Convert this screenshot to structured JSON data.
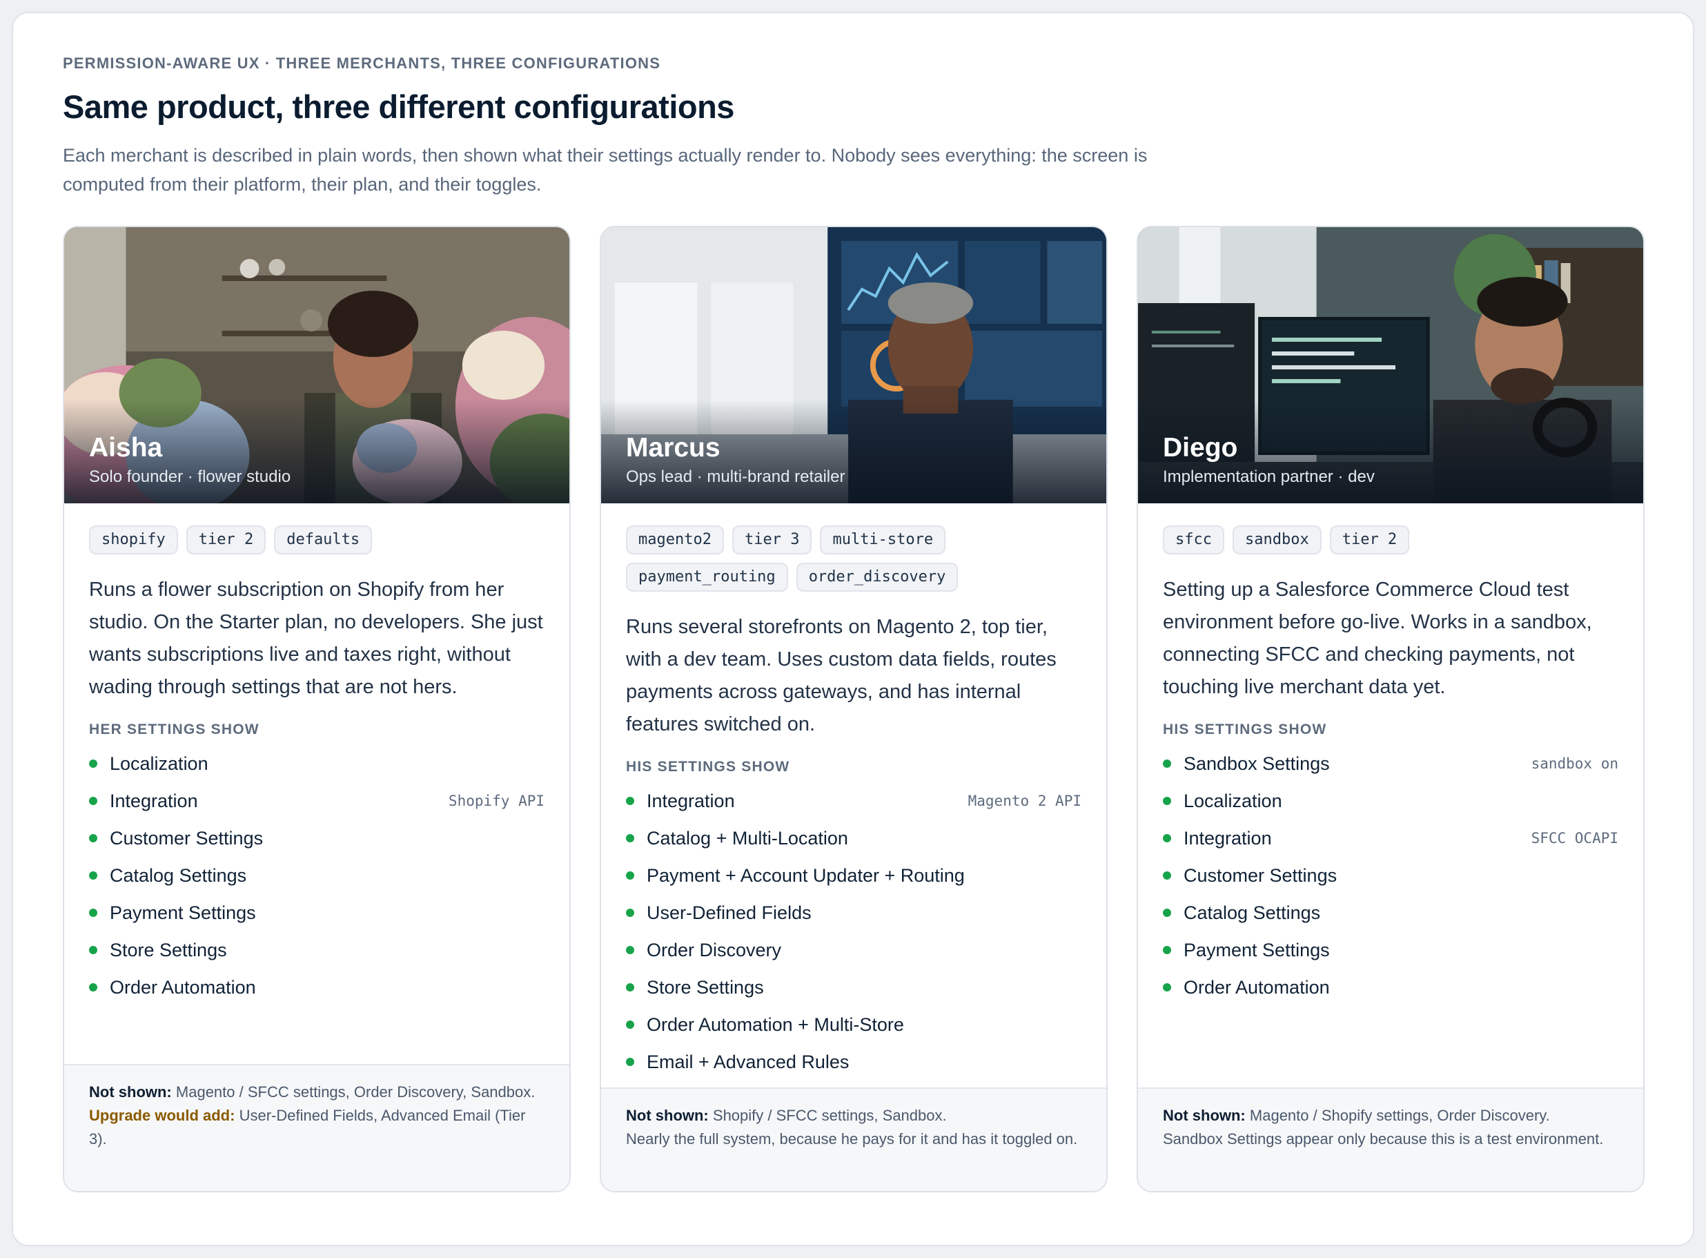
{
  "header": {
    "eyebrow": "PERMISSION-AWARE UX · THREE MERCHANTS, THREE CONFIGURATIONS",
    "title": "Same product, three different configurations",
    "subtitle": "Each merchant is described in plain words, then shown what their settings actually render to. Nobody sees everything: the screen is computed from their platform, their plan, and their toggles."
  },
  "colors": {
    "bullet": "#17a34a",
    "upgrade": "#8a5a00",
    "title": "#0b1c30"
  },
  "cards": [
    {
      "name": "Aisha",
      "role": "Solo founder · flower studio",
      "tags": [
        "shopify",
        "tier 2",
        "defaults"
      ],
      "description": "Runs a flower subscription on Shopify from her studio. On the Starter plan, no developers. She just wants subscriptions live and taxes right, without wading through settings that are not hers.",
      "settings_label": "HER SETTINGS SHOW",
      "settings": [
        {
          "label": "Localization",
          "meta": ""
        },
        {
          "label": "Integration",
          "meta": "Shopify API"
        },
        {
          "label": "Customer Settings",
          "meta": ""
        },
        {
          "label": "Catalog Settings",
          "meta": ""
        },
        {
          "label": "Payment Settings",
          "meta": ""
        },
        {
          "label": "Store Settings",
          "meta": ""
        },
        {
          "label": "Order Automation",
          "meta": ""
        }
      ],
      "not_shown_label": "Not shown:",
      "not_shown": "Magento / SFCC settings, Order Discovery, Sandbox.",
      "upgrade_label": "Upgrade would add:",
      "upgrade": "User-Defined Fields, Advanced Email (Tier 3)."
    },
    {
      "name": "Marcus",
      "role": "Ops lead · multi-brand retailer",
      "tags": [
        "magento2",
        "tier 3",
        "multi-store",
        "payment_routing",
        "order_discovery"
      ],
      "description": "Runs several storefronts on Magento 2, top tier, with a dev team. Uses custom data fields, routes payments across gateways, and has internal features switched on.",
      "settings_label": "HIS SETTINGS SHOW",
      "settings": [
        {
          "label": "Integration",
          "meta": "Magento 2 API"
        },
        {
          "label": "Catalog + Multi-Location",
          "meta": ""
        },
        {
          "label": "Payment + Account Updater + Routing",
          "meta": ""
        },
        {
          "label": "User-Defined Fields",
          "meta": ""
        },
        {
          "label": "Order Discovery",
          "meta": ""
        },
        {
          "label": "Store Settings",
          "meta": ""
        },
        {
          "label": "Order Automation + Multi-Store",
          "meta": ""
        },
        {
          "label": "Email + Advanced Rules",
          "meta": ""
        }
      ],
      "not_shown_label": "Not shown:",
      "not_shown": "Shopify / SFCC settings, Sandbox.",
      "note": "Nearly the full system, because he pays for it and has it toggled on."
    },
    {
      "name": "Diego",
      "role": "Implementation partner · dev",
      "tags": [
        "sfcc",
        "sandbox",
        "tier 2"
      ],
      "description": "Setting up a Salesforce Commerce Cloud test environment before go-live. Works in a sandbox, connecting SFCC and checking payments, not touching live merchant data yet.",
      "settings_label": "HIS SETTINGS SHOW",
      "settings": [
        {
          "label": "Sandbox Settings",
          "meta": "sandbox on"
        },
        {
          "label": "Localization",
          "meta": ""
        },
        {
          "label": "Integration",
          "meta": "SFCC OCAPI"
        },
        {
          "label": "Customer Settings",
          "meta": ""
        },
        {
          "label": "Catalog Settings",
          "meta": ""
        },
        {
          "label": "Payment Settings",
          "meta": ""
        },
        {
          "label": "Order Automation",
          "meta": ""
        }
      ],
      "not_shown_label": "Not shown:",
      "not_shown": "Magento / Shopify settings, Order Discovery.",
      "note": "Sandbox Settings appear only because this is a test environment."
    }
  ]
}
